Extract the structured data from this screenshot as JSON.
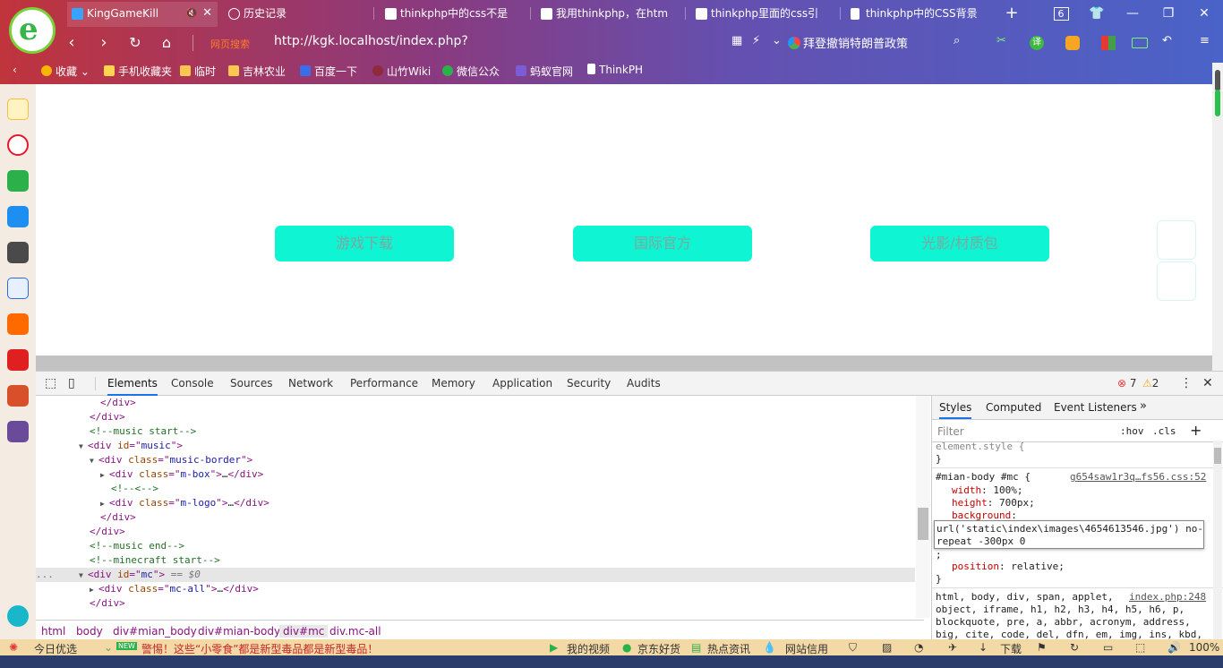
{
  "browser": {
    "tabs": [
      {
        "title": "KingGameKill",
        "active": true
      },
      {
        "title": "历史记录"
      },
      {
        "title": "thinkphp中的css不是"
      },
      {
        "title": "我用thinkphp，在htm"
      },
      {
        "title": "thinkphp里面的css引"
      },
      {
        "title": "thinkphp中的CSS背景"
      }
    ],
    "tab_count": "6",
    "address_label": "网页搜索",
    "url": "http://kgk.localhost/index.php?",
    "news": "拜登撤销特朗普政策",
    "translate_label": "译",
    "bookmarks": [
      {
        "label": "收藏",
        "color": "#f7b500"
      },
      {
        "label": "手机收藏夹",
        "color": "#ffd54f"
      },
      {
        "label": "临时",
        "color": "#f9c74f"
      },
      {
        "label": "吉林农业",
        "color": "#f9c74f"
      },
      {
        "label": "百度一下",
        "color": "#3a6ee8"
      },
      {
        "label": "山竹Wiki",
        "color": "#8e2a3e"
      },
      {
        "label": "微信公众",
        "color": "#2bb14a"
      },
      {
        "label": "蚂蚁官网",
        "color": "#7b5cd6"
      },
      {
        "label": "ThinkPH",
        "color": "#ffffff"
      }
    ]
  },
  "page": {
    "buttons": [
      "游戏下载",
      "国际官方",
      "光影/材质包"
    ]
  },
  "devtools": {
    "tabs": [
      "Elements",
      "Console",
      "Sources",
      "Network",
      "Performance",
      "Memory",
      "Application",
      "Security",
      "Audits"
    ],
    "active_tab": "Elements",
    "errors": "7",
    "warnings": "2",
    "dom_lines": [
      {
        "indent": 5,
        "kind": "close",
        "text": "</div>"
      },
      {
        "indent": 4,
        "kind": "close",
        "text": "</div>"
      },
      {
        "indent": 4,
        "kind": "comment",
        "text": "<!--music start-->"
      },
      {
        "indent": 3,
        "kind": "open",
        "tri": "▼",
        "tag": "div",
        "attr": "id",
        "val": "music"
      },
      {
        "indent": 4,
        "kind": "open",
        "tri": "▼",
        "tag": "div",
        "attr": "class",
        "val": "music-border"
      },
      {
        "indent": 5,
        "kind": "collapsed",
        "tri": "▶",
        "tag": "div",
        "attr": "class",
        "val": "m-box"
      },
      {
        "indent": 6,
        "kind": "comment",
        "text": "<!--<-->"
      },
      {
        "indent": 5,
        "kind": "collapsed",
        "tri": "▶",
        "tag": "div",
        "attr": "class",
        "val": "m-logo"
      },
      {
        "indent": 5,
        "kind": "close",
        "text": "</div>"
      },
      {
        "indent": 4,
        "kind": "close",
        "text": "</div>"
      },
      {
        "indent": 4,
        "kind": "comment",
        "text": "<!--music end-->"
      },
      {
        "indent": 4,
        "kind": "comment",
        "text": "<!--minecraft start-->"
      },
      {
        "indent": 3,
        "kind": "selected",
        "tri": "▼",
        "tag": "div",
        "attr": "id",
        "val": "mc",
        "suffix": " == $0"
      },
      {
        "indent": 4,
        "kind": "collapsed",
        "tri": "▶",
        "tag": "div",
        "attr": "class",
        "val": "mc-all"
      },
      {
        "indent": 4,
        "kind": "close",
        "text": "</div>"
      }
    ],
    "breadcrumbs": [
      "html",
      "body",
      "div#mian_body",
      "div#mian-body",
      "div#mc",
      "div.mc-all"
    ],
    "active_crumb": "div#mc",
    "styles": {
      "tabs": [
        "Styles",
        "Computed",
        "Event Listeners"
      ],
      "filter_placeholder": "Filter",
      "hov": ":hov",
      "cls": ".cls",
      "element_style": "element.style {",
      "rule_selector": "#mian-body #mc {",
      "rule_source": "g654saw1r3q…fs56.css:52",
      "props": [
        {
          "name": "width",
          "value": "100%;"
        },
        {
          "name": "height",
          "value": "700px;"
        },
        {
          "name": "background",
          "value": ""
        }
      ],
      "editing_value_1": "url('static\\index\\images\\4654613546.jpg') no-",
      "editing_value_2": "repeat -300px 0",
      "position_prop": "position",
      "position_val": "relative;",
      "ua_source": "index.php:248",
      "ua_lines": [
        "html, body, div, span, applet,",
        "object, iframe, h1, h2, h3, h4, h5, h6, p,",
        "blockquote, pre, a, abbr, acronym, address,",
        "big, cite, code, del, dfn, em, img, ins, kbd,"
      ]
    }
  },
  "statusbar": {
    "left": "今日优选",
    "new_badge": "NEW",
    "headline": "警惕！这些“小零食”都是新型毒品都是新型毒品！",
    "items": [
      "我的视频",
      "京东好货",
      "热点资讯",
      "网站信用"
    ],
    "download": "下载",
    "zoom": "100%"
  }
}
